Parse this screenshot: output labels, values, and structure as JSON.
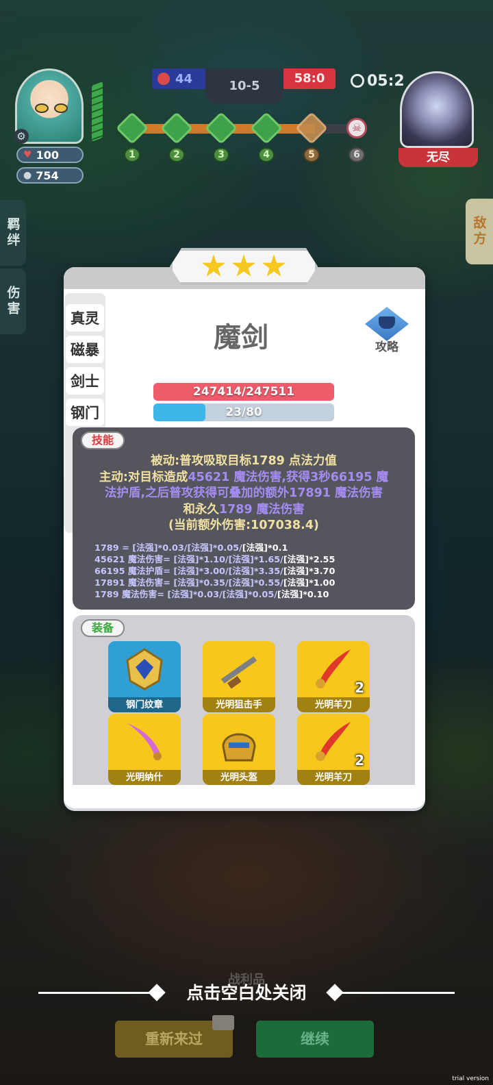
{
  "hud": {
    "player_hp": "100",
    "player_coins": "754",
    "team_score_left": "44",
    "stage": "10-5",
    "team_score_right": "58:0",
    "timer": "05:2",
    "enemy_label": "无尽",
    "progress_nodes": [
      "1",
      "2",
      "3",
      "4",
      "5",
      "6"
    ],
    "progress_fraction": 0.83,
    "icons": {
      "settings": "gear-icon",
      "hp": "heart-icon",
      "coin": "coin-icon",
      "timer": "clock-icon",
      "boss": "skull-icon"
    }
  },
  "side_tabs": {
    "left": [
      "羁绊",
      "伤害"
    ],
    "right": "敌方"
  },
  "card": {
    "stars": 3,
    "traits": [
      "真灵",
      "磁暴",
      "剑士",
      "钢门"
    ],
    "hero_name": "魔剑",
    "guide_label": "攻略",
    "hp_text": "247414/247511",
    "mana_text": "23/80",
    "mana_fraction": 0.2875,
    "skill": {
      "tag": "技能",
      "line1": "被动:普攻吸取目标1789 点法力值",
      "line2_prefix": "主动:对目标造成",
      "line2_num1": "45621",
      "line2_mid": " 魔法伤害,获得3秒",
      "line2_num2": "66195",
      "line2_suffix": " 魔",
      "line3_prefix": "法护盾,之后普攻获得可叠加的额外",
      "line3_num": "17891",
      "line3_suffix": " 魔法伤害",
      "line4_prefix": "和永久",
      "line4_num": "1789",
      "line4_suffix": " 魔法伤害",
      "line5": "(当前额外伤害:107038.4)",
      "formulas": [
        {
          "head": "1789 = [法强]*0.03/[法强]*0.05/",
          "tail": "[法强]*0.1"
        },
        {
          "head": "45621 魔法伤害= [法强]*1.10/[法强]*1.65/",
          "tail": "[法强]*2.55"
        },
        {
          "head": "66195 魔法护盾= [法强]*3.00/[法强]*3.35/",
          "tail": "[法强]*3.70"
        },
        {
          "head": "17891 魔法伤害= [法强]*0.35/[法强]*0.55/",
          "tail": "[法强]*1.00"
        },
        {
          "head": "1789 魔法伤害= [法强]*0.03/[法强]*0.05/",
          "tail": "[法强]*0.10"
        }
      ]
    },
    "equipment": {
      "tag": "装备",
      "items": [
        {
          "name": "钢门纹章",
          "count": "",
          "color": "#2f9fd6"
        },
        {
          "name": "光明狙击手",
          "count": "",
          "color": "#f7c71c"
        },
        {
          "name": "光明羊刀",
          "count": "2",
          "color": "#f7c71c"
        },
        {
          "name": "光明纳什",
          "count": "",
          "color": "#f7c71c"
        },
        {
          "name": "光明头盔",
          "count": "",
          "color": "#f7c71c"
        },
        {
          "name": "光明羊刀",
          "count": "2",
          "color": "#f7c71c"
        }
      ]
    }
  },
  "bottom": {
    "behind_label": "战利品",
    "close_hint": "点击空白处关闭",
    "retry_label": "重新来过",
    "continue_label": "继续",
    "watermark": "trial version"
  }
}
